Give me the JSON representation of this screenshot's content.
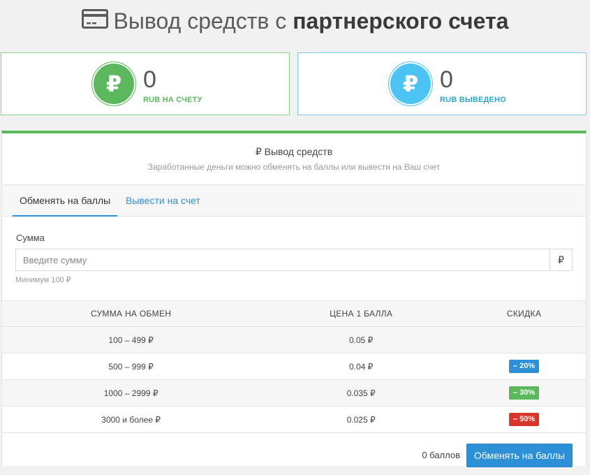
{
  "header": {
    "title_normal": "Вывод средств с ",
    "title_bold": "партнерского счета"
  },
  "stats": [
    {
      "symbol": "₽",
      "value": "0",
      "label": "RUB НА СЧЕТУ",
      "color": "#5cb85c"
    },
    {
      "symbol": "₽",
      "value": "0",
      "label": "RUB ВЫВЕДЕНО",
      "color": "#4bc3f3"
    }
  ],
  "panel": {
    "title": "₽ Вывод средств",
    "subtitle": "Заработанные деньги можно обменять на баллы или вывести на Ваш счет",
    "accent": "#5cb85c"
  },
  "tabs": [
    {
      "label": "Обменять на баллы",
      "active": true
    },
    {
      "label": "Вывести на счет",
      "active": false
    }
  ],
  "form": {
    "label": "Сумма",
    "placeholder": "Введите сумму",
    "addon": "₽",
    "hint": "Минимум 100 ₽"
  },
  "table": {
    "headers": [
      "СУММА НА ОБМЕН",
      "ЦЕНА 1 БАЛЛА",
      "СКИДКА"
    ],
    "rows": [
      {
        "range": "100 – 499 ₽",
        "price": "0.05 ₽",
        "discount": "",
        "badge_color": ""
      },
      {
        "range": "500 – 999 ₽",
        "price": "0.04 ₽",
        "discount": "– 20%",
        "badge_color": "#2d8fd5"
      },
      {
        "range": "1000 – 2999 ₽",
        "price": "0.035 ₽",
        "discount": "– 30%",
        "badge_color": "#5cb85c"
      },
      {
        "range": "3000 и более ₽",
        "price": "0.025 ₽",
        "discount": "– 50%",
        "badge_color": "#d9362b"
      }
    ]
  },
  "footer": {
    "points": "0 баллов",
    "button": "Обменять на баллы"
  }
}
